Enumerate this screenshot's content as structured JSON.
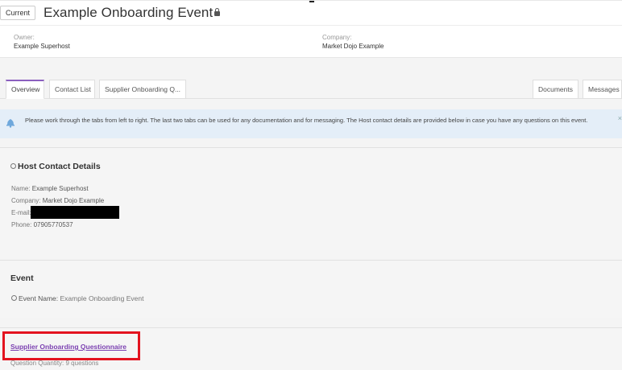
{
  "header": {
    "status": "Current",
    "title": "Example Onboarding Event"
  },
  "info": {
    "owner_label": "Owner:",
    "owner_value": "Example Superhost",
    "company_label": "Company:",
    "company_value": "Market Dojo Example"
  },
  "tabs": {
    "overview": "Overview",
    "contact_list": "Contact List",
    "supplier_onboarding": "Supplier Onboarding Q...",
    "documents": "Documents",
    "messages": "Messages"
  },
  "alert": {
    "text": "Please work through the tabs from left to right. The last two tabs can be used for any documentation and for messaging. The Host contact details are provided below in case you have any questions on this event.",
    "close": "×"
  },
  "host_contact": {
    "heading": "Host Contact Details",
    "name_label": "Name:",
    "name_value": "Example Superhost",
    "company_label": "Company:",
    "company_value": "Market Dojo Example",
    "email_label": "E-mail:",
    "phone_label": "Phone:",
    "phone_value": "07905770537"
  },
  "event": {
    "heading": "Event",
    "name_label": "Event Name:",
    "name_value": "Example Onboarding Event"
  },
  "questionnaire": {
    "link": "Supplier Onboarding Questionnaire",
    "quantity_label": "Question Quantity:",
    "quantity_value": "9 questions"
  },
  "colors": {
    "accent": "#8b5fbf",
    "link": "#7a3fb0",
    "alert_bg": "#e4eef8",
    "highlight": "#e3131f"
  },
  "icons": {
    "lock": "lock-icon",
    "bell": "bell-icon",
    "info": "info-circle-icon"
  }
}
